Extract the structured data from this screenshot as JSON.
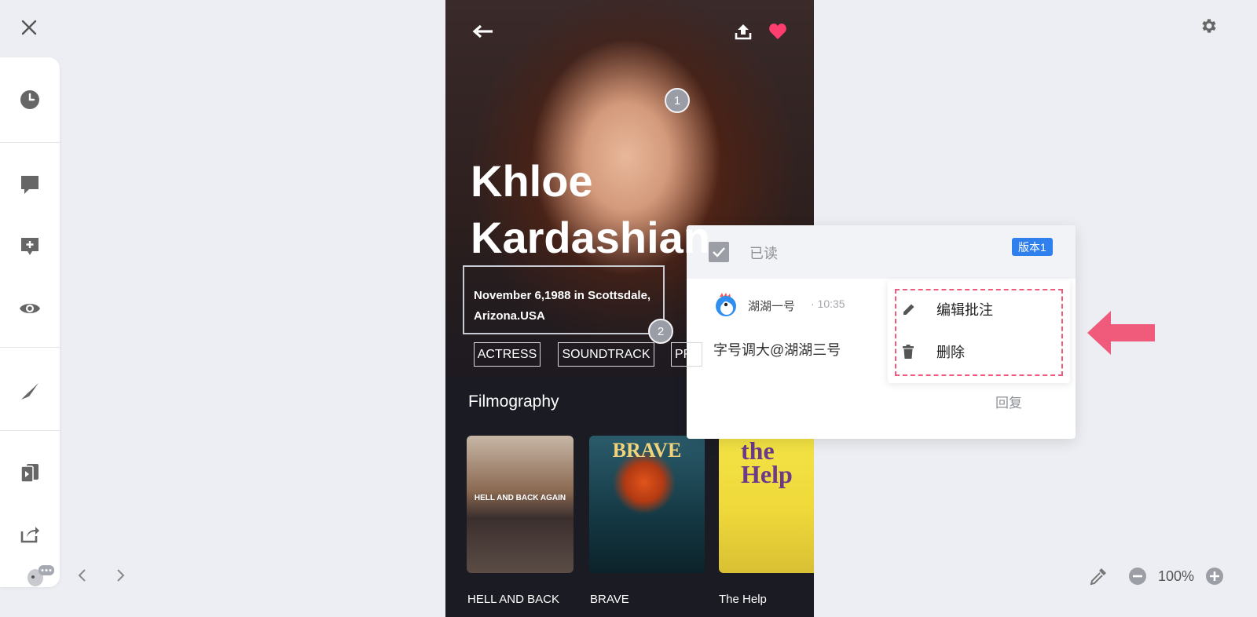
{
  "hero": {
    "first_name": "Khloe",
    "last_name": "Kardashian",
    "birth_line1": "November 6,1988 in Scottsdale,",
    "birth_line2": "Arizona.USA",
    "marker_1": "1",
    "marker_2": "2",
    "tags": [
      "ACTRESS",
      "SOUNDTRACK",
      "PR"
    ]
  },
  "filmography": {
    "title": "Filmography",
    "posters": [
      {
        "caption": "HELL AND BACK",
        "poster_title": "HELL AND BACK AGAIN"
      },
      {
        "caption": "BRAVE",
        "poster_title": "BRAVE"
      },
      {
        "caption": "The Help",
        "poster_title": "the Help"
      }
    ]
  },
  "comment": {
    "read_label": "已读",
    "version": "版本1",
    "author": "湖湖一号",
    "time": "· 10:35",
    "text": "字号调大@湖湖三号",
    "reply": "回复"
  },
  "menu": {
    "edit_label": "编辑批注",
    "delete_label": "删除"
  },
  "zoom": {
    "level": "100%"
  },
  "colors": {
    "accent_pink": "#f05b7c",
    "badge_blue": "#2f80ed",
    "heart": "#ff3d6e"
  }
}
